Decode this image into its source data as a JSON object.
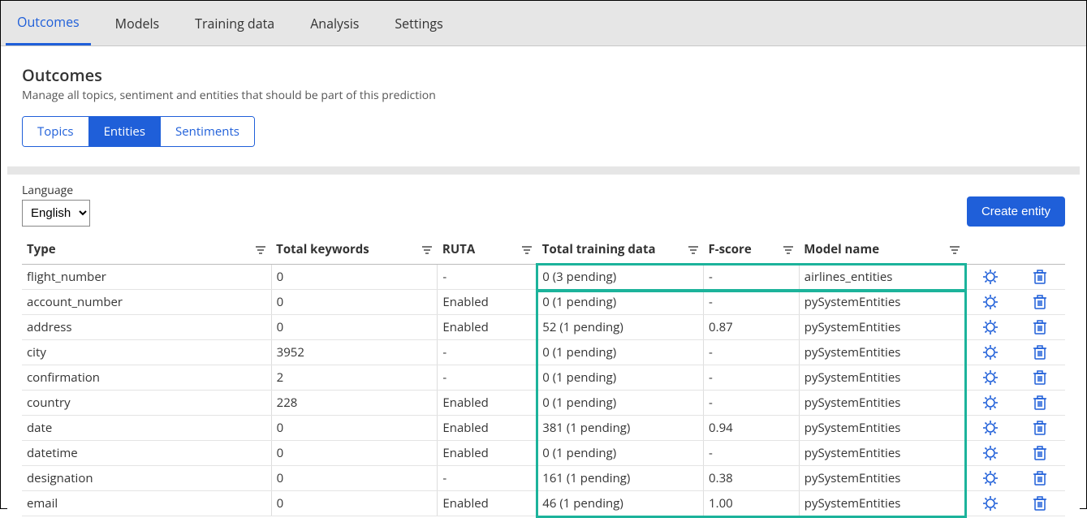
{
  "topbar": {
    "tabs": [
      {
        "label": "Outcomes",
        "active": true
      },
      {
        "label": "Models",
        "active": false
      },
      {
        "label": "Training data",
        "active": false
      },
      {
        "label": "Analysis",
        "active": false
      },
      {
        "label": "Settings",
        "active": false
      }
    ]
  },
  "header": {
    "title": "Outcomes",
    "subtitle": "Manage all topics, sentiment and entities that should be part of this prediction",
    "segments": [
      {
        "label": "Topics",
        "active": false
      },
      {
        "label": "Entities",
        "active": true
      },
      {
        "label": "Sentiments",
        "active": false
      }
    ]
  },
  "controls": {
    "language_label": "Language",
    "language_value": "English",
    "create_button": "Create entity"
  },
  "table": {
    "columns": [
      "Type",
      "Total keywords",
      "RUTA",
      "Total training data",
      "F-score",
      "Model name"
    ],
    "rows": [
      {
        "type": "flight_number",
        "kw": "0",
        "ruta": "-",
        "ttd": "0  (3 pending)",
        "fs": "-",
        "mn": "airlines_entities"
      },
      {
        "type": "account_number",
        "kw": "0",
        "ruta": "Enabled",
        "ttd": "0  (1 pending)",
        "fs": "-",
        "mn": "pySystemEntities"
      },
      {
        "type": "address",
        "kw": "0",
        "ruta": "Enabled",
        "ttd": "52  (1 pending)",
        "fs": "0.87",
        "mn": "pySystemEntities"
      },
      {
        "type": "city",
        "kw": "3952",
        "ruta": "-",
        "ttd": "0  (1 pending)",
        "fs": "-",
        "mn": "pySystemEntities"
      },
      {
        "type": "confirmation",
        "kw": "2",
        "ruta": "-",
        "ttd": "0  (1 pending)",
        "fs": "-",
        "mn": "pySystemEntities"
      },
      {
        "type": "country",
        "kw": "228",
        "ruta": "Enabled",
        "ttd": "0  (1 pending)",
        "fs": "-",
        "mn": "pySystemEntities"
      },
      {
        "type": "date",
        "kw": "0",
        "ruta": "Enabled",
        "ttd": "381  (1 pending)",
        "fs": "0.94",
        "mn": "pySystemEntities"
      },
      {
        "type": "datetime",
        "kw": "0",
        "ruta": "Enabled",
        "ttd": "0  (1 pending)",
        "fs": "-",
        "mn": "pySystemEntities"
      },
      {
        "type": "designation",
        "kw": "0",
        "ruta": "-",
        "ttd": "161  (1 pending)",
        "fs": "0.38",
        "mn": "pySystemEntities"
      },
      {
        "type": "email",
        "kw": "0",
        "ruta": "Enabled",
        "ttd": "46  (1 pending)",
        "fs": "1.00",
        "mn": "pySystemEntities"
      }
    ]
  }
}
